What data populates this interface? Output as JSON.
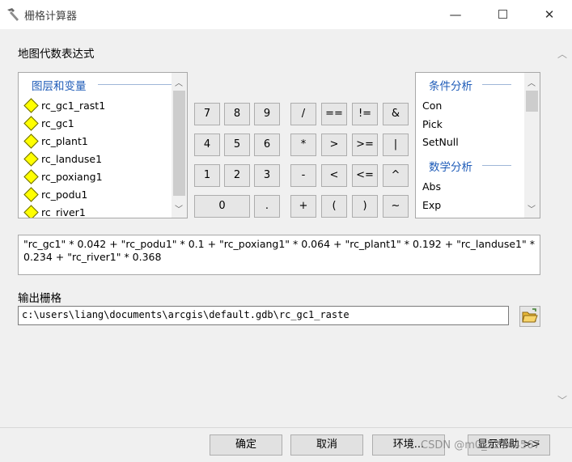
{
  "window": {
    "title": "栅格计算器",
    "minimize": "—",
    "close": "✕"
  },
  "labels": {
    "map_algebra": "地图代数表达式",
    "output_raster": "输出栅格"
  },
  "layers": {
    "header": "图层和变量",
    "items": [
      "rc_gc1_rast1",
      "rc_gc1",
      "rc_plant1",
      "rc_landuse1",
      "rc_poxiang1",
      "rc_podu1",
      "rc_river1"
    ]
  },
  "calculator": {
    "row1": [
      "7",
      "8",
      "9",
      "/",
      "==",
      "!=",
      "&"
    ],
    "row2": [
      "4",
      "5",
      "6",
      "*",
      ">",
      ">=",
      "|"
    ],
    "row3": [
      "1",
      "2",
      "3",
      "-",
      "<",
      "<=",
      "^"
    ],
    "row4": [
      "0",
      ".",
      "+",
      "(",
      ")",
      "~"
    ]
  },
  "functions": {
    "conditional_header": "条件分析",
    "conditional_items": [
      "Con",
      "Pick",
      "SetNull"
    ],
    "math_header": "数学分析",
    "math_items": [
      "Abs",
      "Exp"
    ]
  },
  "expression": "\"rc_gc1\" * 0.042 + \"rc_podu1\" * 0.1 + \"rc_poxiang1\" * 0.064 + \"rc_plant1\" * 0.192 + \"rc_landuse1\" * 0.234 + \"rc_river1\" * 0.368",
  "output_path": "c:\\users\\liang\\documents\\arcgis\\default.gdb\\rc_gc1_raste",
  "buttons": {
    "ok": "确定",
    "cancel": "取消",
    "environments": "环境...",
    "show_help": "显示帮助 >>"
  },
  "watermark": "CSDN @m0_52144567",
  "icons": {
    "title": "hammer-icon",
    "browse": "open-folder-icon",
    "layer": "raster-layer-diamond-icon"
  }
}
